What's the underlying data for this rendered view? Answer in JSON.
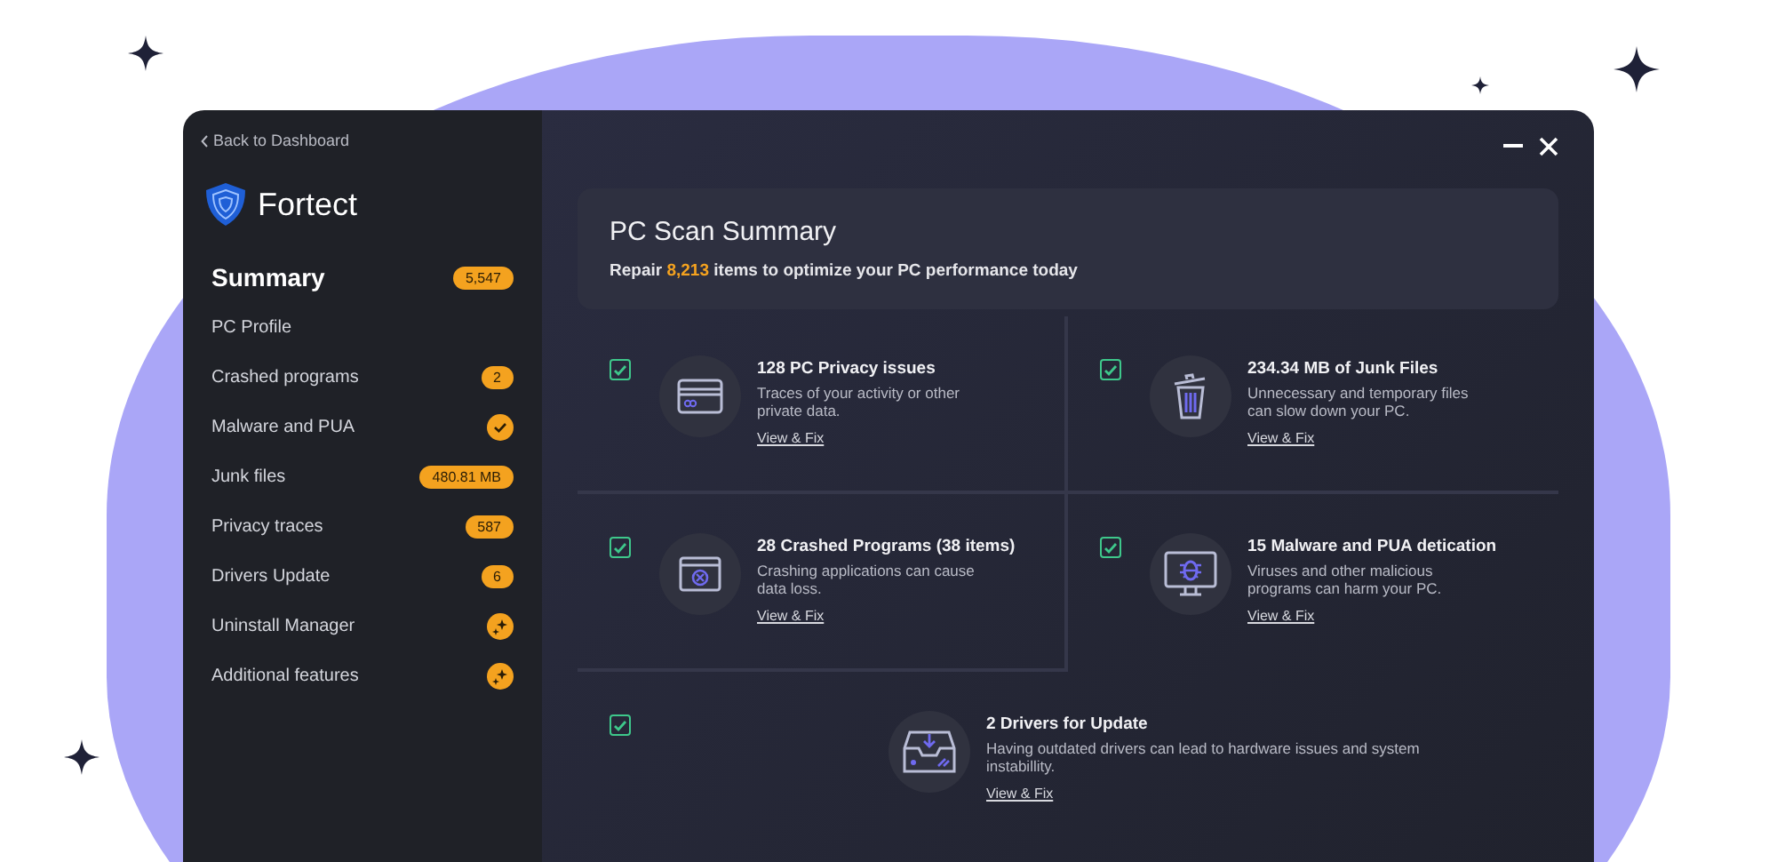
{
  "window": {
    "back_link": "Back to Dashboard",
    "app_name": "Fortect"
  },
  "sidebar": {
    "items": [
      {
        "label": "Summary",
        "selected": true,
        "kind": "count",
        "badge": "5,547"
      },
      {
        "label": "PC Profile",
        "selected": false,
        "kind": "none"
      },
      {
        "label": "Crashed programs",
        "selected": false,
        "kind": "count",
        "badge": "2"
      },
      {
        "label": "Malware and PUA",
        "selected": false,
        "kind": "check"
      },
      {
        "label": "Junk files",
        "selected": false,
        "kind": "count",
        "badge": "480.81 MB"
      },
      {
        "label": "Privacy traces",
        "selected": false,
        "kind": "count",
        "badge": "587"
      },
      {
        "label": "Drivers Update",
        "selected": false,
        "kind": "count",
        "badge": "6"
      },
      {
        "label": "Uninstall Manager",
        "selected": false,
        "kind": "feature"
      },
      {
        "label": "Additional features",
        "selected": false,
        "kind": "feature"
      }
    ]
  },
  "summary": {
    "title": "PC Scan Summary",
    "text": "Repair **8,213** items to optimize your PC performance today"
  },
  "issues": [
    {
      "kind": "privacy",
      "checked": true,
      "title": "128 PC Privacy issues",
      "description": "Traces of your activity or other private data.",
      "link": "View & Fix"
    },
    {
      "kind": "junk",
      "checked": true,
      "title": "234.34 MB of Junk Files",
      "description": "Unnecessary and temporary files can slow down your PC.",
      "link": "View & Fix"
    },
    {
      "kind": "crash",
      "checked": true,
      "title": "28 Crashed Programs (38 items)",
      "description": "Crashing applications can cause data loss.",
      "link": "View & Fix"
    },
    {
      "kind": "malware",
      "checked": true,
      "title": "15 Malware and PUA detication",
      "description": "Viruses and other malicious programs can harm your PC.",
      "link": "View & Fix"
    },
    {
      "kind": "drivers",
      "checked": true,
      "title": "2 Drivers for Update",
      "description": "Having outdated drivers can lead to hardware issues and system instabillity.",
      "link": "View & Fix"
    }
  ]
}
